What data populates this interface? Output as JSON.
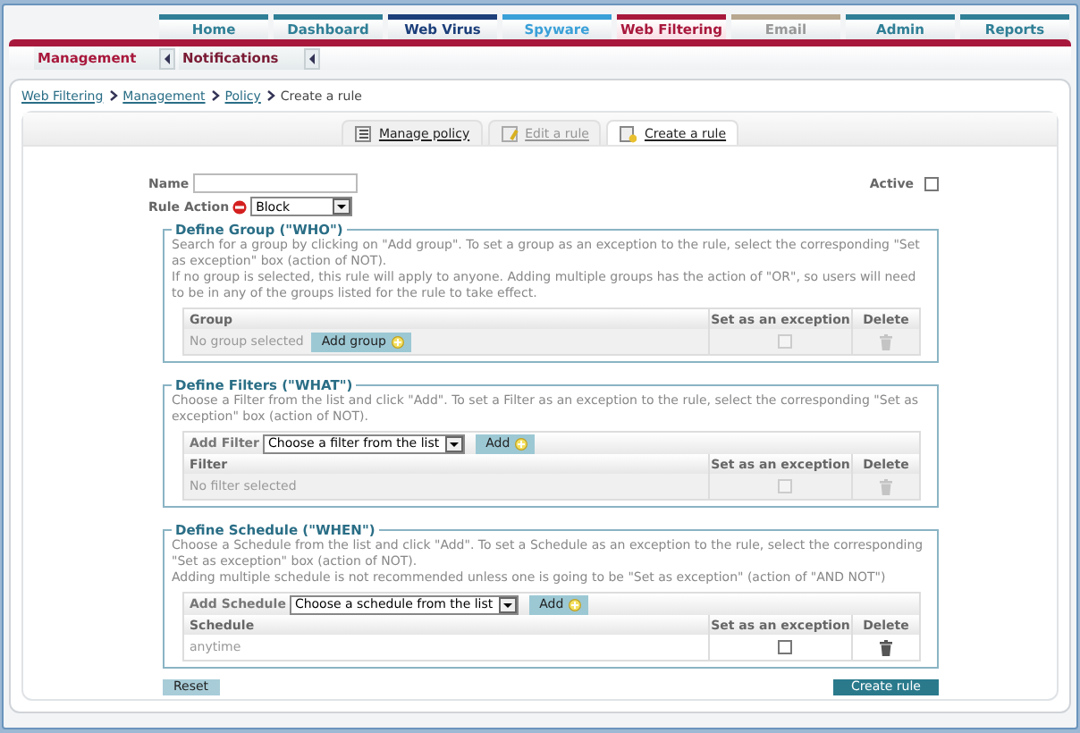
{
  "top_tabs": [
    {
      "label": "Home",
      "color": "#2f7f96",
      "selected": false,
      "disabled": false
    },
    {
      "label": "Dashboard",
      "color": "#2f7f96",
      "selected": false,
      "disabled": false
    },
    {
      "label": "Web Virus",
      "color": "#1c3f7a",
      "selected": false,
      "disabled": false
    },
    {
      "label": "Spyware",
      "color": "#3aa0d8",
      "selected": false,
      "disabled": false
    },
    {
      "label": "Web Filtering",
      "color": "#a8183c",
      "selected": true,
      "disabled": false
    },
    {
      "label": "Email",
      "color": "#b8a890",
      "selected": false,
      "disabled": true
    },
    {
      "label": "Admin",
      "color": "#2f7f96",
      "selected": false,
      "disabled": false
    },
    {
      "label": "Reports",
      "color": "#2f7f96",
      "selected": false,
      "disabled": false
    }
  ],
  "sub_tabs": [
    {
      "label": "Management",
      "selected": true
    },
    {
      "label": "Notifications",
      "selected": false
    }
  ],
  "breadcrumb": [
    {
      "label": "Web Filtering",
      "link": true
    },
    {
      "label": "Management",
      "link": true
    },
    {
      "label": "Policy",
      "link": true
    },
    {
      "label": "Create a rule",
      "link": false
    }
  ],
  "view_tabs": [
    {
      "label": "Manage policy",
      "kind": "list",
      "selected": false,
      "disabled": false
    },
    {
      "label": "Edit a rule",
      "kind": "edit",
      "selected": false,
      "disabled": true
    },
    {
      "label": "Create a rule",
      "kind": "create",
      "selected": true,
      "disabled": false
    }
  ],
  "form": {
    "name_label": "Name",
    "active_label": "Active",
    "active": false,
    "action_label": "Rule Action",
    "action_value": "Block"
  },
  "sections": [
    {
      "title": "Define Group (\"WHO\")",
      "description": [
        "Search for a group by clicking on \"Add group\". To set a group as an exception to the rule, select the corresponding \"Set as exception\" box (action of NOT).",
        "If no group is selected, this rule will apply to anyone. Adding multiple groups has the action of \"OR\", so users will need to be in any of the groups listed for the rule to take effect."
      ],
      "columns": [
        "Group",
        "Set as an exception",
        "Delete"
      ],
      "rows": [
        {
          "text": "No group selected",
          "button": "Add group",
          "exception": false,
          "disabled": true
        }
      ]
    },
    {
      "title": "Define Filters (\"WHAT\")",
      "description": [
        "Choose a Filter from the list and click \"Add\". To set a Filter as an exception to the rule, select the corresponding \"Set as exception\" box (action of NOT)."
      ],
      "add": {
        "label": "Add Filter",
        "select": "Choose a filter from the list",
        "button": "Add"
      },
      "columns": [
        "Filter",
        "Set as an exception",
        "Delete"
      ],
      "rows": [
        {
          "text": "No filter selected",
          "exception": false,
          "disabled": true
        }
      ]
    },
    {
      "title": "Define Schedule (\"WHEN\")",
      "description": [
        "Choose a Schedule from the list and click \"Add\". To set a Schedule as an exception to the rule, select the corresponding \"Set as exception\" box (action of NOT).",
        "Adding multiple schedule is not recommended unless one is going to be \"Set as exception\" (action of \"AND NOT\")"
      ],
      "add": {
        "label": "Add Schedule",
        "select": "Choose a schedule from the list",
        "button": "Add"
      },
      "columns": [
        "Schedule",
        "Set as an exception",
        "Delete"
      ],
      "rows": [
        {
          "text": "anytime",
          "exception": false,
          "disabled": false
        }
      ]
    }
  ],
  "buttons": {
    "reset": "Reset",
    "create": "Create rule"
  }
}
